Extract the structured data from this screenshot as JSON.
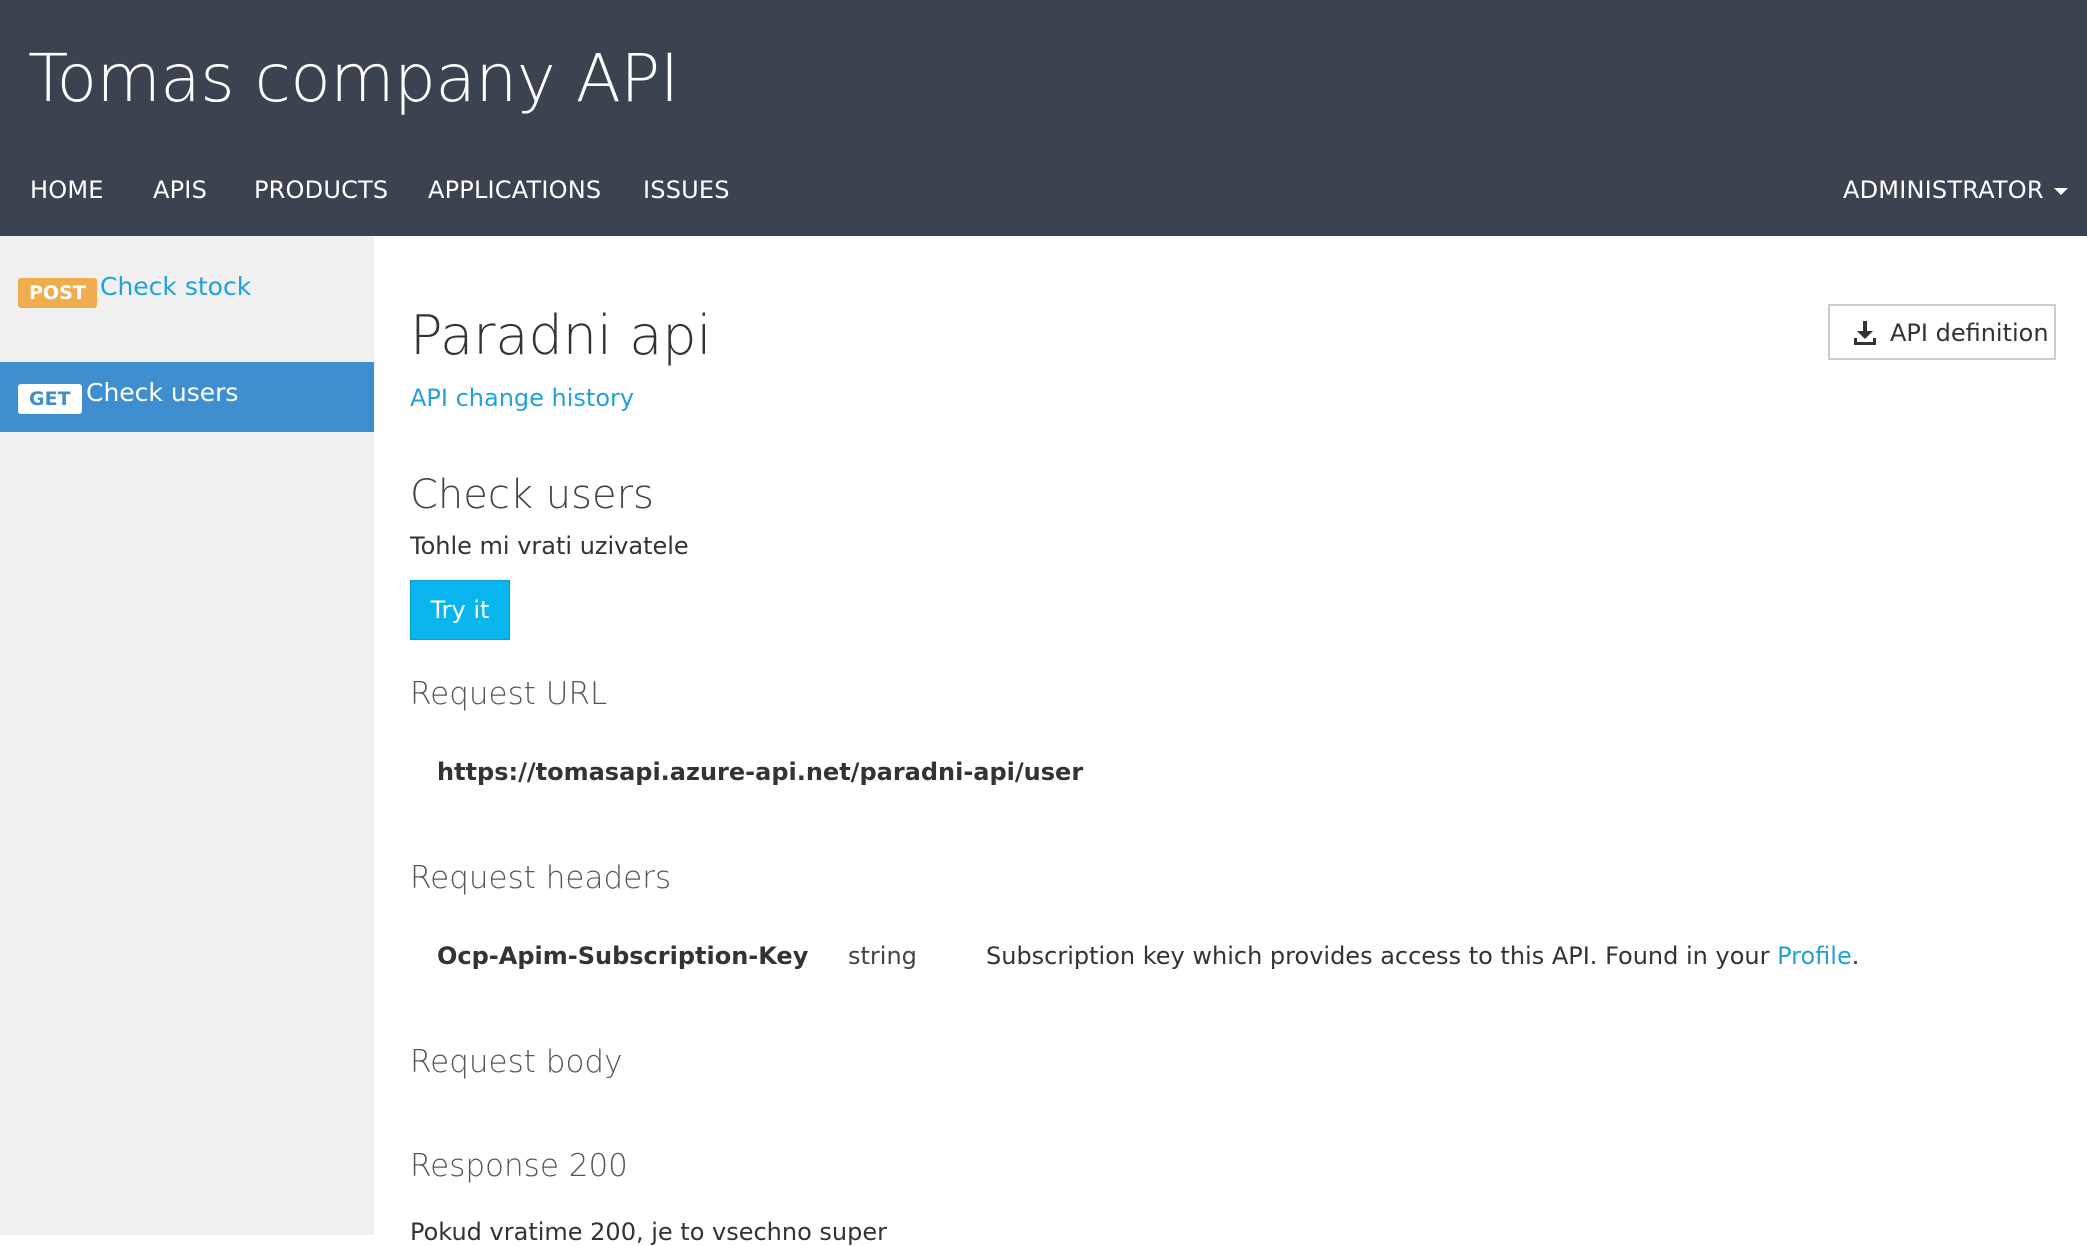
{
  "header": {
    "title": "Tomas company API",
    "nav": [
      "HOME",
      "APIS",
      "PRODUCTS",
      "APPLICATIONS",
      "ISSUES"
    ],
    "user_menu": "ADMINISTRATOR"
  },
  "sidebar": {
    "items": [
      {
        "method": "POST",
        "label": "Check stock",
        "active": false
      },
      {
        "method": "GET",
        "label": "Check users",
        "active": true
      }
    ]
  },
  "main": {
    "api_title": "Paradni api",
    "change_history": "API change history",
    "api_definition_label": "API definition",
    "operation_title": "Check users",
    "operation_description": "Tohle mi vrati uzivatele",
    "try_it_label": "Try it",
    "request_url_title": "Request URL",
    "request_url": "https://tomasapi.azure-api.net/paradni-api/user",
    "request_headers_title": "Request headers",
    "header_row": {
      "name": "Ocp-Apim-Subscription-Key",
      "type": "string",
      "description": "Subscription key which provides access to this API. Found in your",
      "link": "Profile",
      "suffix": "."
    },
    "request_body_title": "Request body",
    "response_title": "Response 200",
    "response_description": "Pokud vratime 200, je to vsechno super"
  },
  "colors": {
    "header_bg": "#3c4350",
    "accent": "#21a2d8",
    "active_item": "#3e8ed0",
    "post_badge": "#f0ad4e",
    "try_button": "#09b5ed"
  }
}
